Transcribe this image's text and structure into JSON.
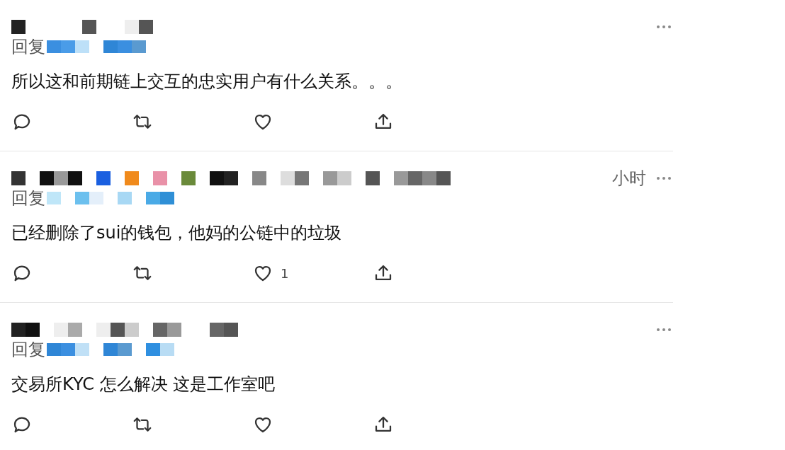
{
  "replies": [
    {
      "reply_label": "回复",
      "text": "所以这和前期链上交互的忠实用户有什么关系。。。"
    },
    {
      "time": "小时",
      "reply_label": "回复",
      "text": "已经删除了sui的钱包，他妈的公链中的垃圾",
      "like_count": "1"
    },
    {
      "reply_label": "回复",
      "text": "交易所KYC 怎么解决  这是工作室吧"
    }
  ]
}
